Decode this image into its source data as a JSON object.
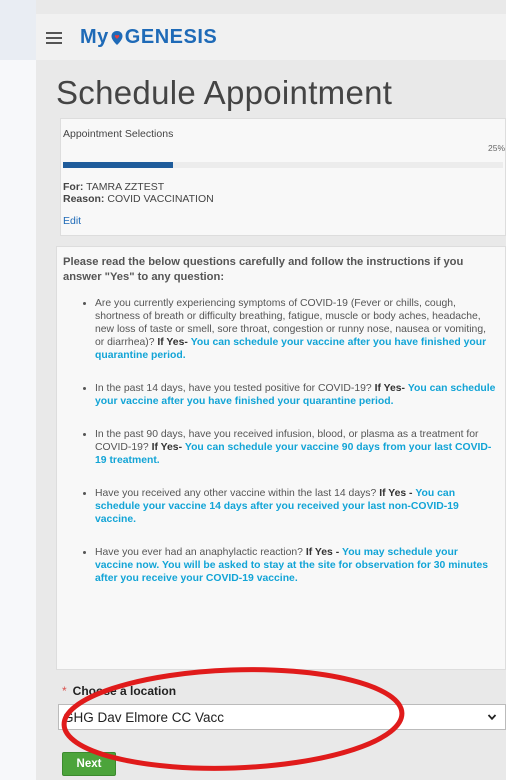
{
  "header": {
    "brand_prefix": "My",
    "brand_name": "GENESIS",
    "menu_icon": "hamburger-menu-icon",
    "brand_color": "#1e6ab7"
  },
  "page": {
    "title": "Schedule Appointment"
  },
  "selections": {
    "title": "Appointment Selections",
    "progress_text": "25%",
    "progress_value": 0.25,
    "for_label": "For:",
    "for_value": "TAMRA ZZTEST",
    "reason_label": "Reason:",
    "reason_value": "COVID VACCINATION",
    "edit_label": "Edit"
  },
  "questions": {
    "intro": "Please read the below questions carefully and follow the instructions if you answer \"Yes\" to any question:",
    "items": [
      {
        "text": "Are you currently experiencing symptoms of COVID-19 (Fever or chills, cough, shortness of breath or difficulty breathing, fatigue, muscle or body aches, headache, new loss of taste or smell, sore throat, congestion or runny nose, nausea or vomiting, or diarrhea)?",
        "yes_label": "If Yes-",
        "yes_text": "You can schedule your vaccine after you have finished your quarantine period."
      },
      {
        "text": "In the past 14 days, have you tested positive for COVID-19?",
        "yes_label": "If Yes-",
        "yes_text": "You can schedule your vaccine after you have finished your quarantine period."
      },
      {
        "text": "In the past 90 days, have you received infusion, blood, or plasma as a treatment for COVID-19?",
        "yes_label": "If Yes-",
        "yes_text": "You can schedule your vaccine 90 days from your last COVID-19 treatment."
      },
      {
        "text": "Have you received any other vaccine within the last 14 days?",
        "yes_label": "If Yes -",
        "yes_text": "You can schedule your vaccine 14 days after you received your last non-COVID-19 vaccine."
      },
      {
        "text": "Have you ever had an anaphylactic reaction?",
        "yes_label": "If Yes -",
        "yes_text": "You may schedule your vaccine now. You will be asked to stay at the site for observation for 30 minutes after you receive your COVID-19 vaccine."
      }
    ]
  },
  "location": {
    "required_marker": "*",
    "label": "Choose a location",
    "selected": "GHG Dav Elmore CC Vacc",
    "chevron_icon": "chevron-down-icon"
  },
  "actions": {
    "next_label": "Next",
    "next_color": "#4ca43b"
  },
  "colors": {
    "accent": "#12a4d6",
    "progress": "#1f5c9b",
    "required": "#d9534f",
    "annotation": "#e01b1b"
  }
}
